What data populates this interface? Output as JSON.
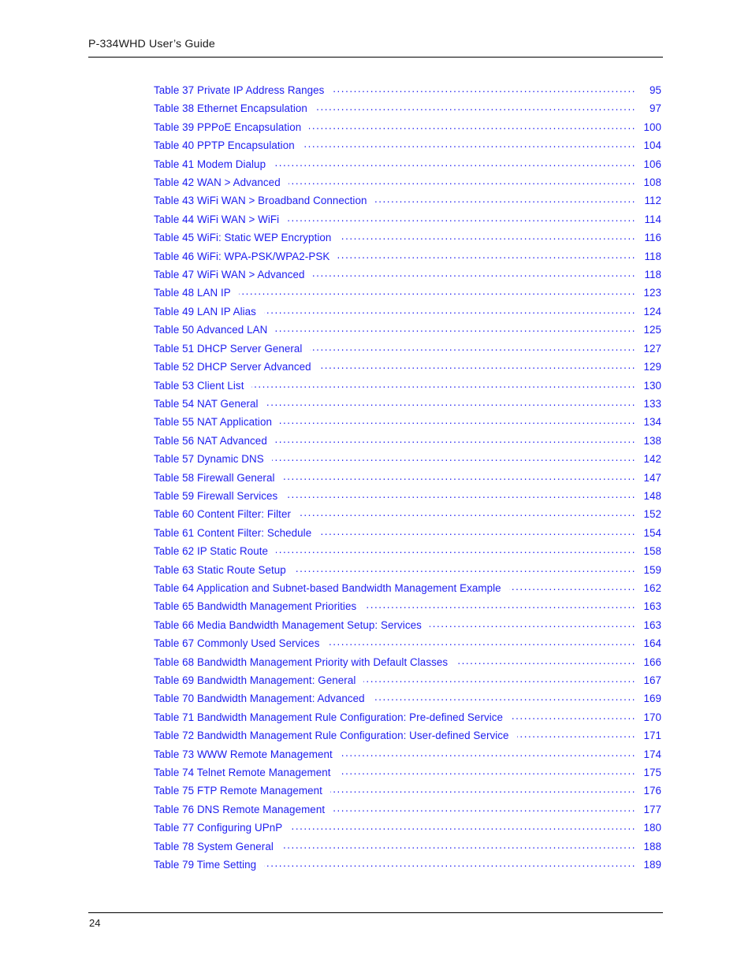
{
  "header": {
    "title": "P-334WHD User’s Guide"
  },
  "footer": {
    "page_number": "24"
  },
  "colors": {
    "toc_link": "#1d1df0",
    "text": "#1a1a1a",
    "rule": "#000000",
    "background": "#ffffff"
  },
  "toc": {
    "entries": [
      {
        "label": "Table 37 Private IP Address Ranges",
        "page": "95"
      },
      {
        "label": "Table 38 Ethernet Encapsulation",
        "page": "97"
      },
      {
        "label": "Table 39 PPPoE Encapsulation",
        "page": "100"
      },
      {
        "label": "Table 40 PPTP Encapsulation",
        "page": "104"
      },
      {
        "label": "Table 41 Modem Dialup",
        "page": "106"
      },
      {
        "label": "Table 42 WAN > Advanced",
        "page": "108"
      },
      {
        "label": "Table 43 WiFi WAN > Broadband Connection",
        "page": "112"
      },
      {
        "label": "Table 44 WiFi WAN > WiFi",
        "page": "114"
      },
      {
        "label": "Table 45 WiFi: Static WEP Encryption",
        "page": "116"
      },
      {
        "label": "Table 46 WiFi: WPA-PSK/WPA2-PSK",
        "page": "118"
      },
      {
        "label": "Table 47 WiFi WAN > Advanced",
        "page": "118"
      },
      {
        "label": "Table 48 LAN IP",
        "page": "123"
      },
      {
        "label": "Table 49 LAN IP Alias",
        "page": "124"
      },
      {
        "label": "Table 50 Advanced LAN",
        "page": "125"
      },
      {
        "label": "Table 51 DHCP Server General",
        "page": "127"
      },
      {
        "label": "Table 52 DHCP Server Advanced",
        "page": "129"
      },
      {
        "label": "Table 53 Client List",
        "page": "130"
      },
      {
        "label": "Table 54 NAT General",
        "page": "133"
      },
      {
        "label": "Table 55 NAT Application",
        "page": "134"
      },
      {
        "label": "Table 56 NAT Advanced",
        "page": "138"
      },
      {
        "label": "Table 57 Dynamic DNS",
        "page": "142"
      },
      {
        "label": "Table 58 Firewall General",
        "page": "147"
      },
      {
        "label": "Table 59 Firewall Services",
        "page": "148"
      },
      {
        "label": "Table 60 Content Filter: Filter",
        "page": "152"
      },
      {
        "label": "Table 61 Content Filter: Schedule",
        "page": "154"
      },
      {
        "label": "Table 62 IP Static Route",
        "page": "158"
      },
      {
        "label": "Table 63 Static Route Setup",
        "page": "159"
      },
      {
        "label": "Table 64 Application and Subnet-based Bandwidth Management Example",
        "page": "162"
      },
      {
        "label": "Table 65 Bandwidth Management Priorities",
        "page": "163"
      },
      {
        "label": "Table 66 Media Bandwidth Management Setup: Services",
        "page": "163"
      },
      {
        "label": "Table 67 Commonly Used Services",
        "page": "164"
      },
      {
        "label": "Table 68 Bandwidth Management Priority with Default Classes",
        "page": "166"
      },
      {
        "label": "Table 69 Bandwidth Management: General",
        "page": "167"
      },
      {
        "label": "Table 70 Bandwidth Management: Advanced",
        "page": "169"
      },
      {
        "label": "Table 71 Bandwidth Management Rule Configuration: Pre-defined Service",
        "page": "170"
      },
      {
        "label": "Table 72 Bandwidth Management Rule Configuration: User-defined Service",
        "page": "171"
      },
      {
        "label": "Table 73 WWW Remote Management",
        "page": "174"
      },
      {
        "label": "Table 74 Telnet Remote Management",
        "page": "175"
      },
      {
        "label": "Table 75 FTP Remote Management",
        "page": "176"
      },
      {
        "label": "Table 76 DNS Remote Management",
        "page": "177"
      },
      {
        "label": "Table 77 Configuring UPnP",
        "page": "180"
      },
      {
        "label": "Table 78 System General",
        "page": "188"
      },
      {
        "label": "Table 79 Time Setting",
        "page": "189"
      }
    ]
  }
}
